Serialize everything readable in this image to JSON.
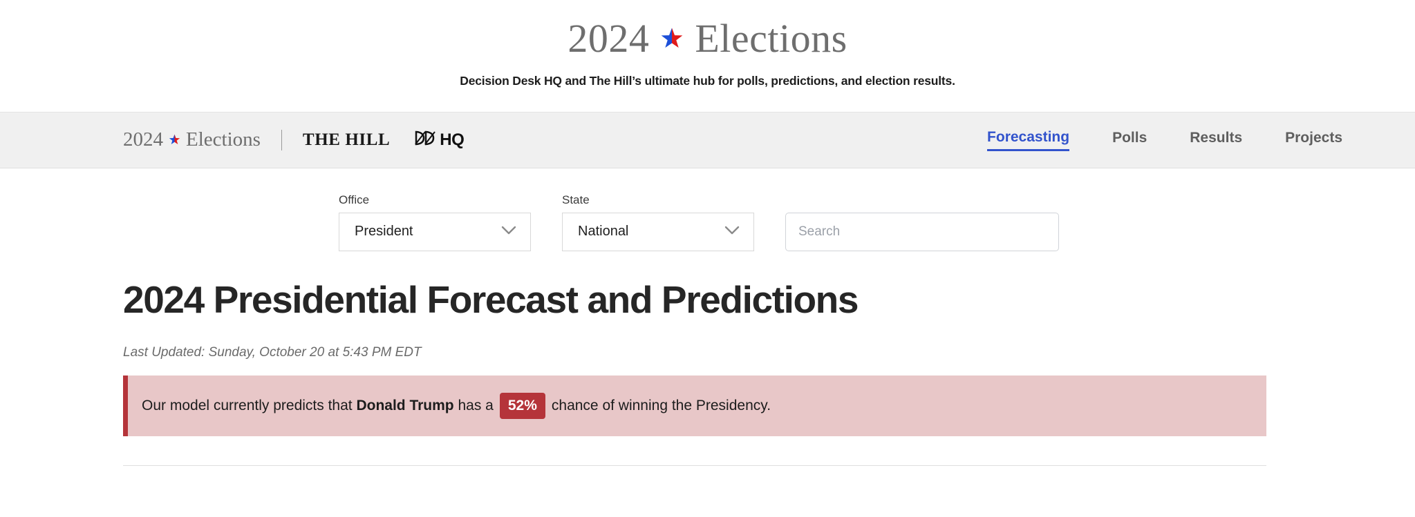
{
  "masthead": {
    "title_year": "2024",
    "title_word": "Elections",
    "star_icon": "star-split-blue-red",
    "subtitle": "Decision Desk HQ and The Hill’s ultimate hub for polls, predictions, and election results."
  },
  "navbar": {
    "brand_year": "2024",
    "brand_word": "Elections",
    "brand_star_icon": "star-split-blue-red",
    "partner_hill": "THE HILL",
    "partner_ddhq_mark": "ddhq-monogram-icon",
    "partner_ddhq_text": "HQ",
    "links": [
      {
        "label": "Forecasting",
        "active": true
      },
      {
        "label": "Polls",
        "active": false
      },
      {
        "label": "Results",
        "active": false
      },
      {
        "label": "Projects",
        "active": false
      }
    ],
    "active_color": "#3253cc",
    "background": "#f0f0f0"
  },
  "filters": {
    "office": {
      "label": "Office",
      "value": "President",
      "chevron_icon": "chevron-down-icon"
    },
    "state": {
      "label": "State",
      "value": "National",
      "chevron_icon": "chevron-down-icon"
    },
    "search": {
      "placeholder": "Search",
      "value": ""
    }
  },
  "main": {
    "page_title": "2024 Presidential Forecast and Predictions",
    "last_updated": "Last Updated: Sunday, October 20 at 5:43 PM EDT",
    "callout": {
      "text_before": "Our model currently predicts that",
      "candidate": "Donald Trump",
      "text_middle": "has a",
      "percent": "52%",
      "text_after": "chance of winning the Presidency.",
      "background": "#e8c7c8",
      "accent": "#b5343a"
    }
  }
}
